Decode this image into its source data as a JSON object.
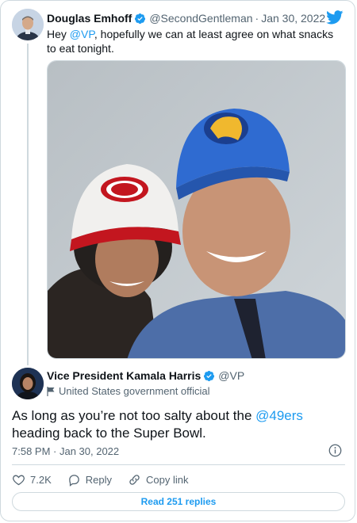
{
  "tweet": {
    "author_name": "Douglas Emhoff",
    "handle": "@SecondGentleman",
    "separator": "·",
    "date": "Jan 30, 2022",
    "text_prefix": "Hey ",
    "mention": "@VP",
    "text_suffix": ", hopefully we can at least agree on what snacks to eat tonight."
  },
  "quote": {
    "author_name": "Vice President Kamala Harris",
    "handle": "@VP",
    "affiliation": "United States government official",
    "text_prefix": "As long as you’re not too salty about the ",
    "mention": "@49ers",
    "text_suffix": " heading back to the Super Bowl.",
    "timestamp": "7:58 PM · Jan 30, 2022"
  },
  "actions": {
    "like_count": "7.2K",
    "reply_label": "Reply",
    "copy_label": "Copy link",
    "read_replies_label": "Read 251 replies"
  },
  "colors": {
    "accent": "#1d9bf0",
    "text": "#0f1419",
    "muted": "#536471",
    "border": "#cfd9de"
  },
  "icons": [
    "twitter-bird-icon",
    "verified-badge-icon",
    "flag-icon",
    "info-icon",
    "heart-icon",
    "reply-bubble-icon",
    "link-icon"
  ]
}
